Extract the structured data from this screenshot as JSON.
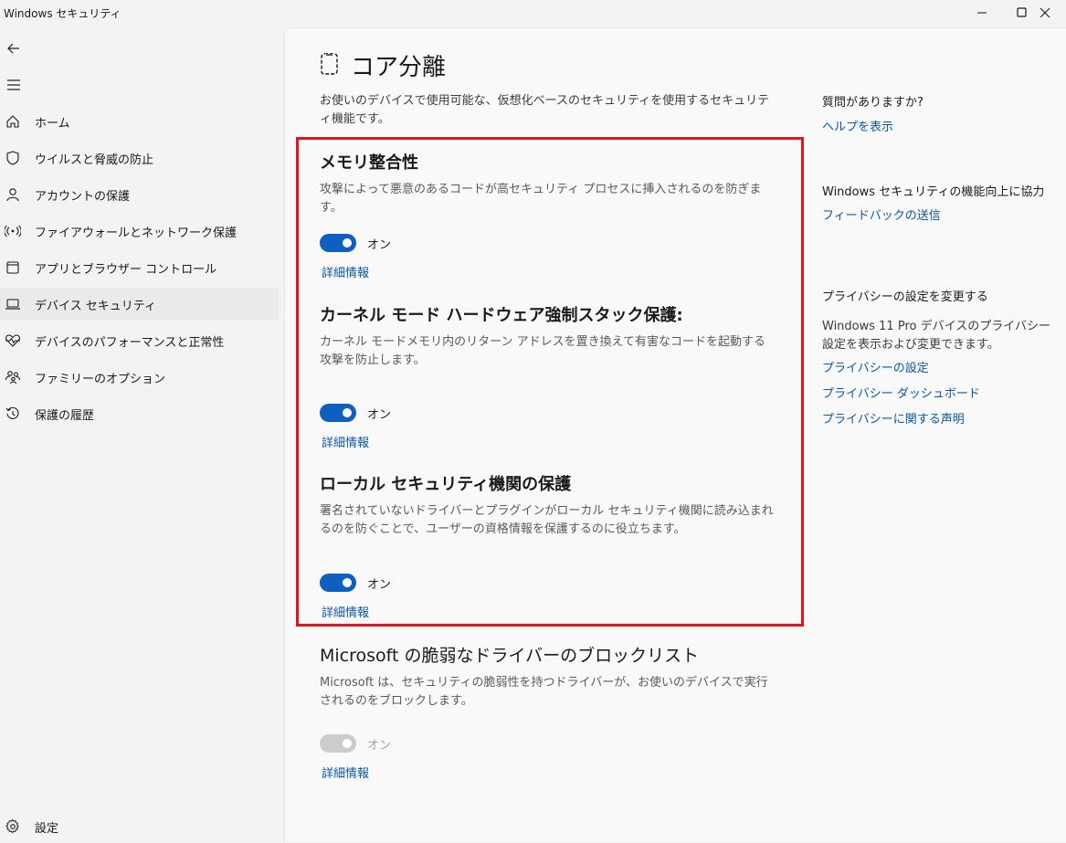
{
  "window": {
    "title": "Windows セキュリティ"
  },
  "sidebar": {
    "items": [
      {
        "label": "ホーム",
        "icon": "home-icon"
      },
      {
        "label": "ウイルスと脅威の防止",
        "icon": "shield-icon"
      },
      {
        "label": "アカウントの保護",
        "icon": "person-icon"
      },
      {
        "label": "ファイアウォールとネットワーク保護",
        "icon": "wireless-icon"
      },
      {
        "label": "アプリとブラウザー コントロール",
        "icon": "browser-icon"
      },
      {
        "label": "デバイス セキュリティ",
        "icon": "laptop-icon",
        "selected": true
      },
      {
        "label": "デバイスのパフォーマンスと正常性",
        "icon": "heartbeat-icon"
      },
      {
        "label": "ファミリーのオプション",
        "icon": "family-icon"
      },
      {
        "label": "保護の履歴",
        "icon": "history-icon"
      }
    ],
    "settings_label": "設定"
  },
  "main": {
    "title": "コア分離",
    "intro": "お使いのデバイスで使用可能な、仮想化ベースのセキュリティを使用するセキュリティ機能です。",
    "sections": [
      {
        "heading": "メモリ整合性",
        "description": "攻撃によって悪意のあるコードが高セキュリティ プロセスに挿入されるのを防ぎます。",
        "toggle_state": "オン",
        "enabled": true,
        "link": "詳細情報"
      },
      {
        "heading": "カーネル モード ハードウェア強制スタック保護:",
        "description": "カーネル モードメモリ内のリターン アドレスを置き換えて有害なコードを起動する攻撃を防止します。",
        "toggle_state": "オン",
        "enabled": true,
        "link": "詳細情報"
      },
      {
        "heading": "ローカル セキュリティ機関の保護",
        "description": "署名されていないドライバーとプラグインがローカル セキュリティ機関に読み込まれるのを防ぐことで、ユーザーの資格情報を保護するのに役立ちます。",
        "toggle_state": "オン",
        "enabled": true,
        "link": "詳細情報"
      },
      {
        "heading": "Microsoft の脆弱なドライバーのブロックリスト",
        "description": "Microsoft は、セキュリティの脆弱性を持つドライバーが、お使いのデバイスで実行されるのをブロックします。",
        "toggle_state": "オン",
        "enabled": false,
        "link": "詳細情報"
      }
    ]
  },
  "rail": {
    "question_heading": "質問がありますか?",
    "help_link": "ヘルプを表示",
    "improve_heading": "Windows セキュリティの機能向上に協力",
    "feedback_link": "フィードバックの送信",
    "privacy_heading": "プライバシーの設定を変更する",
    "privacy_text": "Windows 11 Pro デバイスのプライバシー設定を表示および変更できます。",
    "privacy_links": [
      "プライバシーの設定",
      "プライバシー ダッシュボード",
      "プライバシーに関する声明"
    ]
  },
  "colors": {
    "accent": "#0f5fc0",
    "link": "#0a57a8",
    "highlight_border": "#e3141e"
  }
}
